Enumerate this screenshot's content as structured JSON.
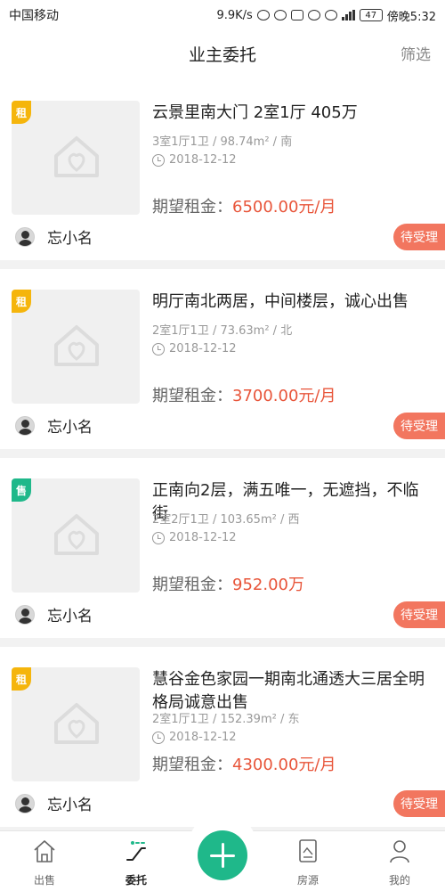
{
  "status_bar": {
    "carrier": "中国移动",
    "speed": "9.9K/s",
    "battery": "47",
    "time": "傍晚5:32"
  },
  "header": {
    "title": "业主委托",
    "filter": "筛选"
  },
  "cards": [
    {
      "tag": "租",
      "tag_type": "rent",
      "title": "云景里南大门 2室1厅 405万",
      "meta": "3室1厅1卫 / 98.74m² / 南",
      "date": "2018-12-12",
      "price_label": "期望租金：",
      "price_value": "6500.00元/月",
      "owner": "忘小名",
      "status": "待受理"
    },
    {
      "tag": "租",
      "tag_type": "rent",
      "title": "明厅南北两居，中间楼层，诚心出售",
      "meta": "2室1厅1卫 / 73.63m² / 北",
      "date": "2018-12-12",
      "price_label": "期望租金：",
      "price_value": "3700.00元/月",
      "owner": "忘小名",
      "status": "待受理"
    },
    {
      "tag": "售",
      "tag_type": "sale",
      "title": "正南向2层，满五唯一，无遮挡，不临街",
      "meta": "2室2厅1卫 / 103.65m² / 西",
      "date": "2018-12-12",
      "price_label": "期望租金：",
      "price_value": "952.00万",
      "owner": "忘小名",
      "status": "待受理"
    },
    {
      "tag": "租",
      "tag_type": "rent",
      "title": "慧谷金色家园一期南北通透大三居全明格局诚意出售",
      "meta": "2室1厅1卫 / 152.39m² / 东",
      "date": "2018-12-12",
      "price_label": "期望租金：",
      "price_value": "4300.00元/月",
      "owner": "忘小名",
      "status": "待受理"
    }
  ],
  "tabbar": {
    "items": [
      {
        "label": "出售",
        "icon": "home-icon"
      },
      {
        "label": "委托",
        "icon": "escalator-icon"
      },
      {
        "label": "房源",
        "icon": "property-card-icon"
      },
      {
        "label": "我的",
        "icon": "person-icon"
      }
    ],
    "active": "委托",
    "fab_icon": "plus-icon"
  },
  "colors": {
    "accent": "#1fb88a",
    "rent_tag": "#f5b50c",
    "sale_tag": "#1fb88a",
    "price": "#e8553a",
    "status_badge": "#f2765f"
  }
}
